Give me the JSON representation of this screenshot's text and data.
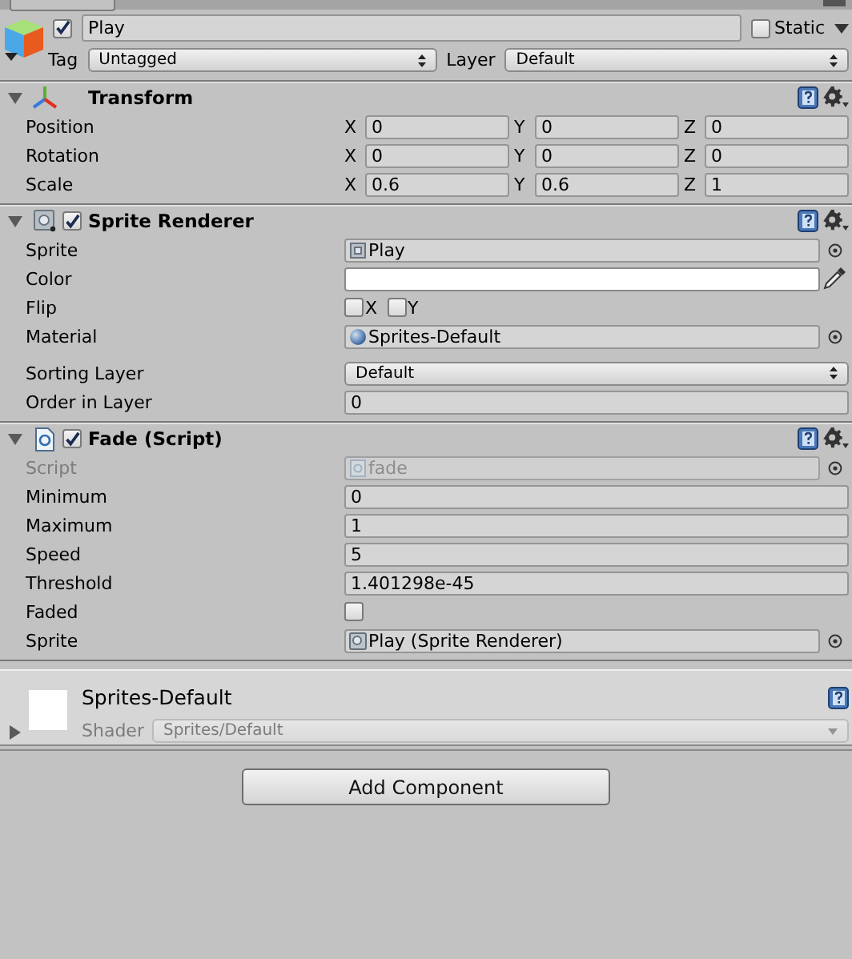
{
  "object": {
    "active": true,
    "name": "Play",
    "static": false,
    "static_label": "Static",
    "tag_label": "Tag",
    "tag": "Untagged",
    "layer_label": "Layer",
    "layer": "Default"
  },
  "components": [
    {
      "kind": "transform",
      "title": "Transform",
      "expanded": true,
      "rows": [
        {
          "kind": "xyz",
          "label": "Position",
          "disabled": false,
          "fields": [
            {
              "axis": "X",
              "value": "0"
            },
            {
              "axis": "Y",
              "value": "0"
            },
            {
              "axis": "Z",
              "value": "0"
            }
          ]
        },
        {
          "kind": "xyz",
          "label": "Rotation",
          "disabled": false,
          "fields": [
            {
              "axis": "X",
              "value": "0"
            },
            {
              "axis": "Y",
              "value": "0"
            },
            {
              "axis": "Z",
              "value": "0"
            }
          ]
        },
        {
          "kind": "xyz",
          "label": "Scale",
          "disabled": false,
          "fields": [
            {
              "axis": "X",
              "value": "0.6"
            },
            {
              "axis": "Y",
              "value": "0.6"
            },
            {
              "axis": "Z",
              "value": "1"
            }
          ]
        }
      ]
    },
    {
      "kind": "sprite_renderer",
      "title": "Sprite Renderer",
      "enabled": true,
      "expanded": true,
      "rows": [
        {
          "kind": "sprite_ref",
          "label": "Sprite",
          "value": "Play",
          "disabled": false
        },
        {
          "kind": "color",
          "label": "Color",
          "color": "#ffffff",
          "disabled": false
        },
        {
          "kind": "flip",
          "label": "Flip",
          "disabled": false,
          "fields": [
            {
              "axis": "X",
              "checked": false
            },
            {
              "axis": "Y",
              "checked": false
            }
          ]
        },
        {
          "kind": "material_ref",
          "label": "Material",
          "value": "Sprites-Default",
          "disabled": false
        },
        {
          "kind": "dropdown",
          "label": "Sorting Layer",
          "value": "Default",
          "disabled": false
        },
        {
          "kind": "number",
          "label": "Order in Layer",
          "value": "0",
          "disabled": false
        }
      ]
    },
    {
      "kind": "script",
      "title": "Fade (Script)",
      "enabled": true,
      "expanded": true,
      "rows": [
        {
          "kind": "script_ref",
          "label": "Script",
          "value": "fade",
          "disabled": true
        },
        {
          "kind": "number",
          "label": "Minimum",
          "value": "0",
          "disabled": false
        },
        {
          "kind": "number",
          "label": "Maximum",
          "value": "1",
          "disabled": false
        },
        {
          "kind": "number",
          "label": "Speed",
          "value": "5",
          "disabled": false
        },
        {
          "kind": "number",
          "label": "Threshold",
          "value": "1.401298e-45",
          "disabled": false
        },
        {
          "kind": "checkbox",
          "label": "Faded",
          "checked": false,
          "disabled": false
        },
        {
          "kind": "component_ref",
          "label": "Sprite",
          "value": "Play (Sprite Renderer)",
          "disabled": false
        }
      ]
    }
  ],
  "material": {
    "name": "Sprites-Default",
    "expanded": false,
    "shader_label": "Shader",
    "shader": "Sprites/Default"
  },
  "add_button": "Add Component"
}
